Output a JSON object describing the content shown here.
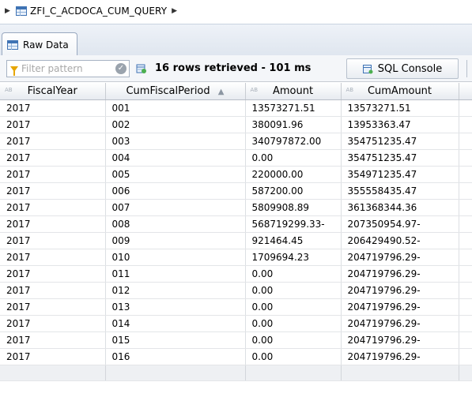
{
  "breadcrumb": {
    "title": "ZFI_C_ACDOCA_CUM_QUERY"
  },
  "tab": {
    "label": "Raw Data"
  },
  "toolbar": {
    "filter_placeholder": "Filter pattern",
    "status": "16 rows retrieved - 101 ms",
    "sql_console_label": "SQL Console"
  },
  "table": {
    "columns": [
      {
        "label": "FiscalYear",
        "type_tag": "AB",
        "sorted": false
      },
      {
        "label": "CumFiscalPeriod",
        "type_tag": "",
        "sorted": true
      },
      {
        "label": "Amount",
        "type_tag": "AB",
        "sorted": false
      },
      {
        "label": "CumAmount",
        "type_tag": "AB",
        "sorted": false
      }
    ],
    "rows": [
      [
        "2017",
        "001",
        "13573271.51",
        "13573271.51"
      ],
      [
        "2017",
        "002",
        "380091.96",
        "13953363.47"
      ],
      [
        "2017",
        "003",
        "340797872.00",
        "354751235.47"
      ],
      [
        "2017",
        "004",
        "0.00",
        "354751235.47"
      ],
      [
        "2017",
        "005",
        "220000.00",
        "354971235.47"
      ],
      [
        "2017",
        "006",
        "587200.00",
        "355558435.47"
      ],
      [
        "2017",
        "007",
        "5809908.89",
        "361368344.36"
      ],
      [
        "2017",
        "008",
        "568719299.33-",
        "207350954.97-"
      ],
      [
        "2017",
        "009",
        "921464.45",
        "206429490.52-"
      ],
      [
        "2017",
        "010",
        "1709694.23",
        "204719796.29-"
      ],
      [
        "2017",
        "011",
        "0.00",
        "204719796.29-"
      ],
      [
        "2017",
        "012",
        "0.00",
        "204719796.29-"
      ],
      [
        "2017",
        "013",
        "0.00",
        "204719796.29-"
      ],
      [
        "2017",
        "014",
        "0.00",
        "204719796.29-"
      ],
      [
        "2017",
        "015",
        "0.00",
        "204719796.29-"
      ],
      [
        "2017",
        "016",
        "0.00",
        "204719796.29-"
      ]
    ]
  },
  "icons": {
    "breadcrumb_expand": "triangle-right-icon",
    "table": "table-icon",
    "filter": "funnel-icon",
    "clear": "clear-filter-icon",
    "rows": "rows-retrieved-icon",
    "sql": "sql-console-icon",
    "sort": "sort-ascending-icon"
  },
  "colors": {
    "accent": "#3f73b4",
    "filter_icon": "#e6a500"
  }
}
